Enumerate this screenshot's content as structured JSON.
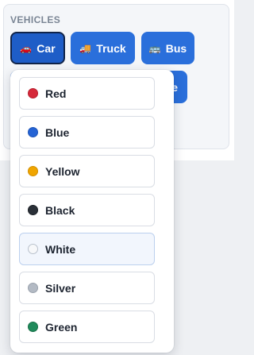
{
  "section": {
    "label": "VEHICLES"
  },
  "vehicles": [
    {
      "emoji": "🚗",
      "label": "Car",
      "active": true
    },
    {
      "emoji": "🚚",
      "label": "Truck",
      "active": false
    },
    {
      "emoji": "🚌",
      "label": "Bus",
      "active": false
    },
    {
      "partial_label": "cle"
    }
  ],
  "colors": [
    {
      "label": "Red",
      "hex": "#d62839",
      "border": "#b71f2f"
    },
    {
      "label": "Blue",
      "hex": "#2563d4",
      "border": "#1f55b8"
    },
    {
      "label": "Yellow",
      "hex": "#f0a500",
      "border": "#d18f00"
    },
    {
      "label": "Black",
      "hex": "#2b3038",
      "border": "#1c2026"
    },
    {
      "label": "White",
      "hex": "#f7f8fa",
      "border": "#b9c1cc",
      "hovered": true
    },
    {
      "label": "Silver",
      "hex": "#b3bac4",
      "border": "#9aa2ad"
    },
    {
      "label": "Green",
      "hex": "#1f8a5b",
      "border": "#187048"
    }
  ],
  "theme": {
    "accent": "#2a6fdb",
    "active_border": "#10244a"
  }
}
